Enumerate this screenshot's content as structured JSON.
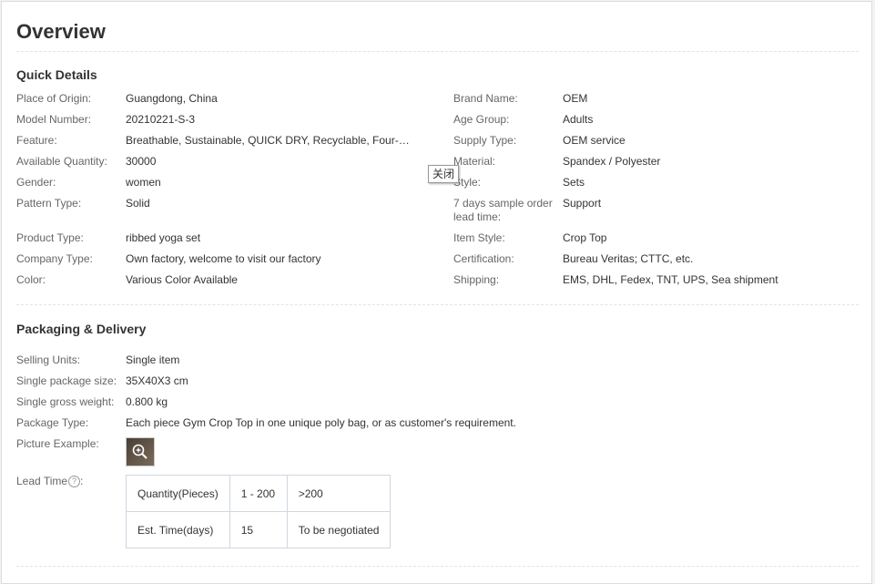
{
  "title": "Overview",
  "quick_details": {
    "heading": "Quick Details",
    "left": [
      {
        "label": "Place of Origin:",
        "value": "Guangdong, China"
      },
      {
        "label": "Model Number:",
        "value": "20210221-S-3"
      },
      {
        "label": "Feature:",
        "value": "Breathable, Sustainable, QUICK DRY, Recyclable, Four-Way St..."
      },
      {
        "label": "Available Quantity:",
        "value": "30000"
      },
      {
        "label": "Gender:",
        "value": "women"
      },
      {
        "label": "Pattern Type:",
        "value": "Solid"
      },
      {
        "label": "Product Type:",
        "value": "ribbed yoga set"
      },
      {
        "label": "Company Type:",
        "value": "Own factory, welcome to visit our factory"
      },
      {
        "label": "Color:",
        "value": "Various Color Available"
      }
    ],
    "right": [
      {
        "label": "Brand Name:",
        "value": "OEM"
      },
      {
        "label": "Age Group:",
        "value": "Adults"
      },
      {
        "label": "Supply Type:",
        "value": "OEM service"
      },
      {
        "label": "Material:",
        "value": "Spandex / Polyester"
      },
      {
        "label": "Style:",
        "value": "Sets"
      },
      {
        "label": "7 days sample order lead time:",
        "value": "Support"
      },
      {
        "label": "Item Style:",
        "value": "Crop Top"
      },
      {
        "label": "Certification:",
        "value": "Bureau Veritas; CTTC, etc."
      },
      {
        "label": "Shipping:",
        "value": "EMS, DHL, Fedex, TNT, UPS, Sea shipment"
      }
    ],
    "tooltip": "关闭"
  },
  "packaging": {
    "heading": "Packaging & Delivery",
    "rows": [
      {
        "label": "Selling Units:",
        "value": "Single item"
      },
      {
        "label": "Single package size:",
        "value": "35X40X3 cm"
      },
      {
        "label": "Single gross weight:",
        "value": "0.800 kg"
      },
      {
        "label": "Package Type:",
        "value": "Each piece Gym Crop Top in one unique poly bag, or as customer's requirement."
      },
      {
        "label": "Picture Example:",
        "value": ""
      }
    ],
    "lead_time": {
      "label": "Lead Time",
      "help": "?",
      "suffix": ":",
      "rows": [
        [
          "Quantity(Pieces)",
          "1 - 200",
          ">200"
        ],
        [
          "Est. Time(days)",
          "15",
          "To be negotiated"
        ]
      ]
    }
  }
}
